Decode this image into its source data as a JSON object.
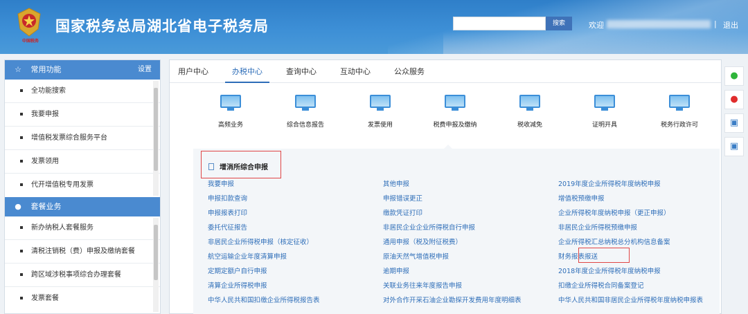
{
  "header": {
    "title": "国家税务总局湖北省电子税务局",
    "emblem_text": "中国税务",
    "search_placeholder": "",
    "search_button": "搜索",
    "welcome": "欢迎",
    "separator": "|",
    "logout": "退出"
  },
  "sidebar": {
    "section1": {
      "title": "常用功能",
      "setting": "设置",
      "icon": "star-icon",
      "items": [
        "全功能搜索",
        "我要申报",
        "增值税发票综合服务平台",
        "发票领用",
        "代开增值税专用发票"
      ]
    },
    "section2": {
      "title": "套餐业务",
      "icon": "globe-icon",
      "items": [
        "新办纳税人套餐服务",
        "清税注销税（费）申报及缴纳套餐",
        "跨区域涉税事项综合办理套餐",
        "发票套餐"
      ]
    }
  },
  "tabs": [
    "用户中心",
    "办税中心",
    "查询中心",
    "互动中心",
    "公众服务"
  ],
  "active_tab": "办税中心",
  "categories": [
    "高频业务",
    "综合信息报告",
    "发票使用",
    "税费申报及缴纳",
    "税收减免",
    "证明开具",
    "税务行政许可"
  ],
  "sub_panel": {
    "title": "增消所综合申报",
    "col1": [
      "我要申报",
      "申报扣款查询",
      "申报报表打印",
      "委托代征报告",
      "非居民企业所得税申报（核定征收）",
      "航空运输企业年度清算申报",
      "定期定额户自行申报",
      "清算企业所得税申报",
      "中华人民共和国扣缴企业所得税报告表"
    ],
    "col2": [
      "其他申报",
      "申报错误更正",
      "缴款凭证打印",
      "非居民企业企业所得税自行申报",
      "通用申报（税及附征税费）",
      "原油天然气增值税申报",
      "逾期申报",
      "关联业务往来年度报告申报",
      "对外合作开采石油企业勘探开发费用年度明细表"
    ],
    "col3": [
      "2019年度企业所得税年度纳税申报",
      "增值税预缴申报",
      "企业所得税年度纳税申报（更正申报）",
      "非居民企业所得税预缴申报",
      "企业所得税汇总纳税总分机构信息备案",
      "财务报表报送",
      "2018年度企业所得税年度纳税申报",
      "扣缴企业所得税合同备案登记",
      "中华人民共和国非居民企业所得税年度纳税申报表"
    ]
  },
  "float_buttons": [
    "wechat-icon",
    "weibo-icon",
    "app-icon",
    "app-icon"
  ],
  "colors": {
    "header": "#3d8fd6",
    "accent": "#2d6db8",
    "highlight": "#e04545"
  }
}
